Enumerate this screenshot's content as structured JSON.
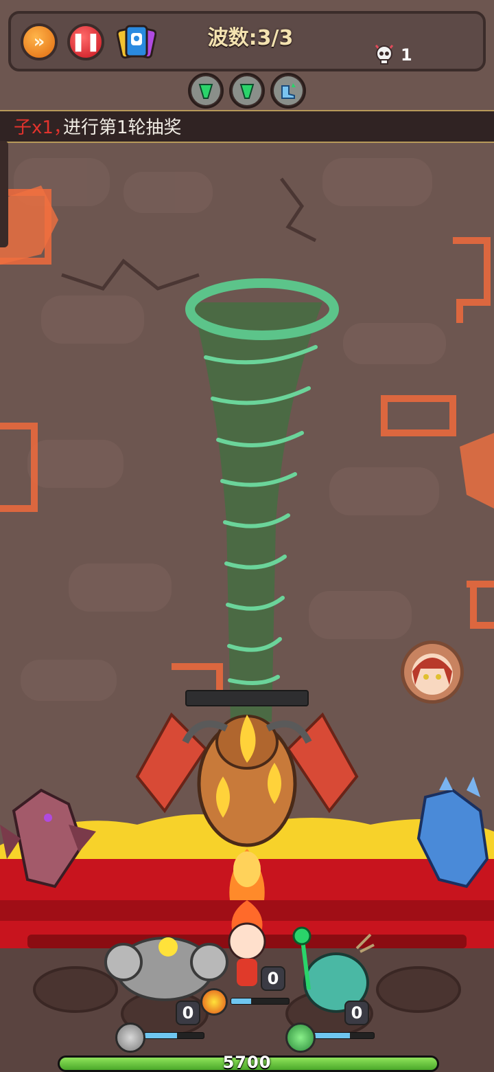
{
  "hud": {
    "wave_label": "波数:3/3",
    "kill_count": "1",
    "speed_button": "speed-up",
    "pause_button": "pause",
    "card_button": "hero-cards"
  },
  "buffs": [
    {
      "icon": "green-tornado-buff-icon"
    },
    {
      "icon": "green-tornado-buff-icon"
    },
    {
      "icon": "blue-boot-speed-buff-icon"
    }
  ],
  "announcement": {
    "prefix": "子x1，",
    "text": "进行第1轮抽奖"
  },
  "heroes": [
    {
      "name": "stone-golem",
      "level": "0",
      "energy": 0.55
    },
    {
      "name": "fire-boy",
      "level": "0",
      "energy": 0.35
    },
    {
      "name": "jade-deer-bird",
      "level": "0",
      "energy": 0.6
    }
  ],
  "base": {
    "hp": "5700",
    "hp_fraction": 1.0
  },
  "colors": {
    "lava": "#e23a1c",
    "tornado": "#3f6e3e",
    "hud_text": "#f3e2b0",
    "hp_green": "#6fd43d"
  }
}
